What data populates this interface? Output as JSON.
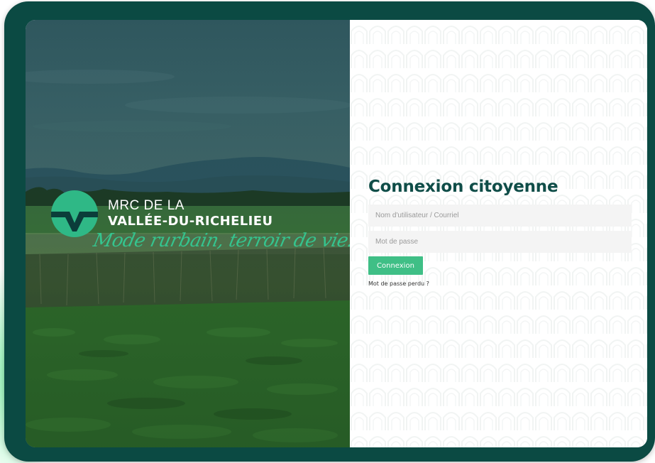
{
  "brand": {
    "line1": "MRC DE LA",
    "line2": "VALLÉE-DU-RICHELIEU",
    "tagline": "Mode rurbain, terroir de vie!",
    "accent_color": "#2fb886",
    "dark_color": "#0b4a43"
  },
  "login": {
    "title": "Connexion citoyenne",
    "username_placeholder": "Nom d'utilisateur / Courriel",
    "password_placeholder": "Mot de passe",
    "submit_label": "Connexion",
    "lost_password_label": "Mot de passe perdu ?",
    "button_color": "#3fbf86"
  },
  "hero_image": "farm-field-landscape"
}
